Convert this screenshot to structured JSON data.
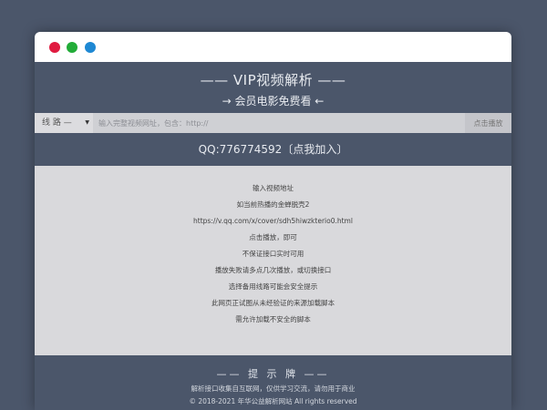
{
  "header": {
    "title": "—— VIP视频解析 ——",
    "subtitle": "→ 会员电影免费看 ←"
  },
  "search": {
    "line_select": "线 路 —",
    "placeholder": "输入完整视频网址，包含：http://",
    "play_label": "点击播放"
  },
  "qq": {
    "text": "QQ:776774592〔点我加入〕"
  },
  "instructions": [
    "输入视频地址",
    "如当前热播的金蝉脱壳2",
    "https://v.qq.com/x/cover/sdh5hiwzkterio0.html",
    "点击播放，即可",
    "不保证接口实时可用",
    "播放失败请多点几次播放，或切换接口",
    "选择备用线路可能会安全提示",
    "此网页正试图从未经验证的来源加载脚本",
    "需允许加载不安全的脚本"
  ],
  "footer": {
    "title": "—— 提 示 牌 ——",
    "line1": "解析接口收集自互联网，仅供学习交流，请勿用于商业",
    "line2": "© 2018-2021 年华公益解析网站 All rights reserved"
  },
  "colors": {
    "window_close": "#e01b40",
    "window_minimize": "#22ac38",
    "window_maximize": "#1e88d3",
    "background": "#4b566a"
  }
}
